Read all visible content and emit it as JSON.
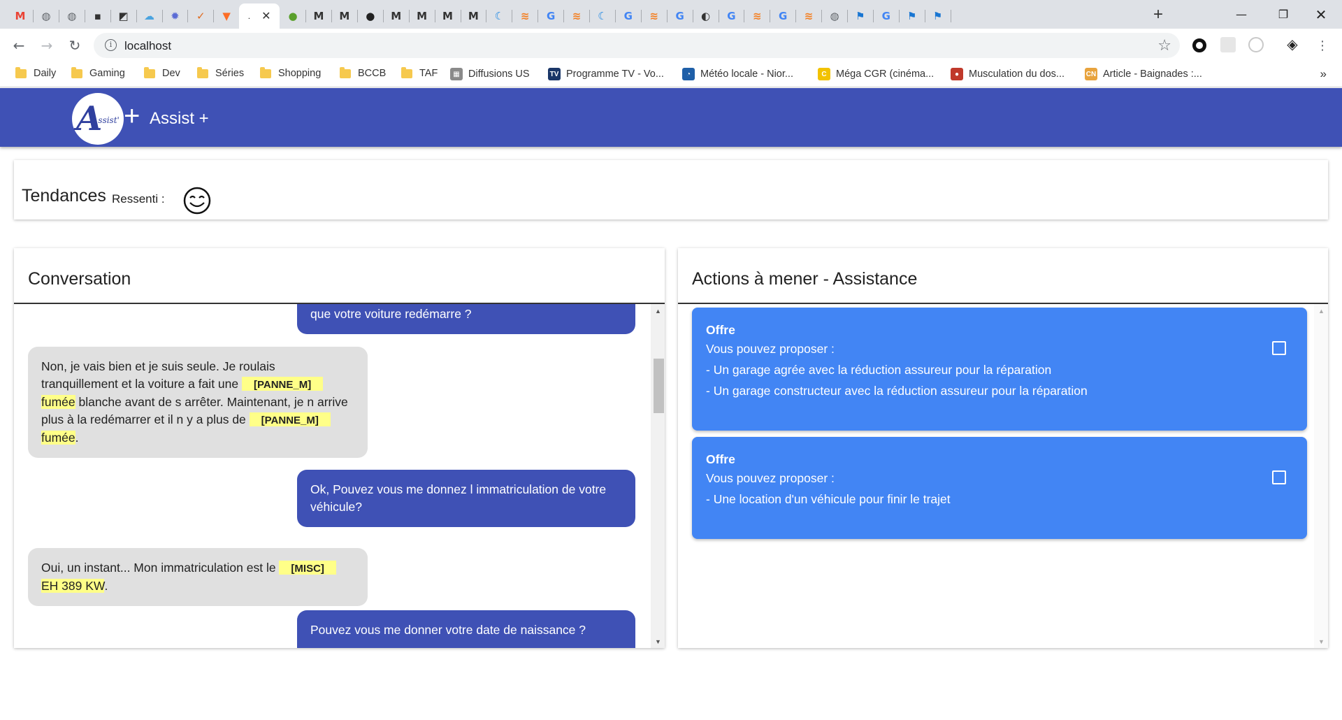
{
  "browser": {
    "tabs": [
      {
        "icon": "gmail-icon",
        "glyph": "M",
        "color": "#ea4335"
      },
      {
        "icon": "globe-icon",
        "glyph": "◍",
        "color": "#5f6368"
      },
      {
        "icon": "globe-icon",
        "glyph": "◍",
        "color": "#5f6368"
      },
      {
        "icon": "lock-icon",
        "glyph": "▪",
        "color": "#333333"
      },
      {
        "icon": "image-icon",
        "glyph": "◩",
        "color": "#333333"
      },
      {
        "icon": "cloud-icon",
        "glyph": "☁",
        "color": "#4aa3df"
      },
      {
        "icon": "gear-icon",
        "glyph": "✹",
        "color": "#5b6bd5"
      },
      {
        "icon": "check-shield-icon",
        "glyph": "✓",
        "color": "#e06b1f"
      },
      {
        "icon": "gitlab-icon",
        "glyph": "▼",
        "color": "#fc6d26"
      },
      {
        "icon": "active-tab",
        "glyph": "",
        "color": "#ffffff"
      },
      {
        "icon": "green-circle-icon",
        "glyph": "●",
        "color": "#5aa02c"
      },
      {
        "icon": "m-icon",
        "glyph": "M",
        "color": "#333333"
      },
      {
        "icon": "m-icon",
        "glyph": "M",
        "color": "#333333"
      },
      {
        "icon": "github-icon",
        "glyph": "●",
        "color": "#222222"
      },
      {
        "icon": "m-icon",
        "glyph": "M",
        "color": "#333333"
      },
      {
        "icon": "m-icon",
        "glyph": "M",
        "color": "#333333"
      },
      {
        "icon": "m-icon",
        "glyph": "M",
        "color": "#333333"
      },
      {
        "icon": "m-icon",
        "glyph": "M",
        "color": "#333333"
      },
      {
        "icon": "wave-icon",
        "glyph": "☾",
        "color": "#1e88e5"
      },
      {
        "icon": "stack-icon",
        "glyph": "≋",
        "color": "#f48024"
      },
      {
        "icon": "google-icon",
        "glyph": "G",
        "color": "#4285f4"
      },
      {
        "icon": "stack-icon",
        "glyph": "≋",
        "color": "#f48024"
      },
      {
        "icon": "wave-icon",
        "glyph": "☾",
        "color": "#1e88e5"
      },
      {
        "icon": "google-icon",
        "glyph": "G",
        "color": "#4285f4"
      },
      {
        "icon": "stack-icon",
        "glyph": "≋",
        "color": "#f48024"
      },
      {
        "icon": "google-icon",
        "glyph": "G",
        "color": "#4285f4"
      },
      {
        "icon": "half-circle-icon",
        "glyph": "◐",
        "color": "#333333"
      },
      {
        "icon": "google-icon",
        "glyph": "G",
        "color": "#4285f4"
      },
      {
        "icon": "stack-icon",
        "glyph": "≋",
        "color": "#f48024"
      },
      {
        "icon": "google-icon",
        "glyph": "G",
        "color": "#4285f4"
      },
      {
        "icon": "stack-icon",
        "glyph": "≋",
        "color": "#f48024"
      },
      {
        "icon": "globe-icon",
        "glyph": "◍",
        "color": "#5f6368"
      },
      {
        "icon": "flag-icon",
        "glyph": "⚑",
        "color": "#1976d2"
      },
      {
        "icon": "google-icon",
        "glyph": "G",
        "color": "#4285f4"
      },
      {
        "icon": "flag-icon",
        "glyph": "⚑",
        "color": "#1976d2"
      },
      {
        "icon": "flag-icon",
        "glyph": "⚑",
        "color": "#1976d2"
      }
    ],
    "active_tab_label": ".",
    "new_tab": "+",
    "url": "localhost",
    "bookmarks": [
      {
        "label": "Daily",
        "type": "folder"
      },
      {
        "label": "Gaming",
        "type": "folder"
      },
      {
        "label": "Dev",
        "type": "folder"
      },
      {
        "label": "Séries",
        "type": "folder"
      },
      {
        "label": "Shopping",
        "type": "folder"
      },
      {
        "label": "BCCB",
        "type": "folder"
      },
      {
        "label": "TAF",
        "type": "folder"
      },
      {
        "label": "Diffusions US",
        "type": "site",
        "icon_color": "#8a8a8a",
        "glyph": "▦"
      },
      {
        "label": "Programme TV - Vo...",
        "type": "site",
        "icon_color": "#1a3668",
        "glyph": "TV"
      },
      {
        "label": "Météo locale - Nior...",
        "type": "site",
        "icon_color": "#1f5fa8",
        "glyph": "◔"
      },
      {
        "label": "Méga CGR (cinéma...",
        "type": "site",
        "icon_color": "#f2c200",
        "glyph": "C"
      },
      {
        "label": "Musculation du dos...",
        "type": "site",
        "icon_color": "#c0392b",
        "glyph": "●"
      },
      {
        "label": "Article - Baignades :...",
        "type": "site",
        "icon_color": "#e8a33d",
        "glyph": "CN"
      }
    ],
    "bookmarks_more": "»"
  },
  "app": {
    "logo_letter": "A",
    "logo_small": "ssist'",
    "logo_plus": "+",
    "title": "Assist +",
    "primary_color": "#3f51b5",
    "offer_color": "#4285f4",
    "tag_color": "#ffff88"
  },
  "trends": {
    "title": "Tendances",
    "ressenti_label": "Ressenti :",
    "mood_icon": "smiley-face-icon"
  },
  "conversation": {
    "title": "Conversation",
    "messages": [
      {
        "role": "agent",
        "text": "que votre voiture redémarre ?"
      },
      {
        "role": "client",
        "parts": [
          {
            "t": "Non, je vais bien et je suis seule. Je roulais tranquillement et la voiture a fait une "
          },
          {
            "tag": "[PANNE_M]",
            "t": "fumée"
          },
          {
            "t": " blanche avant de s arrêter. Maintenant, je n arrive plus à la redémarrer et il n y a plus de "
          },
          {
            "tag": "[PANNE_M]",
            "t": "fumée"
          },
          {
            "t": "."
          }
        ]
      },
      {
        "role": "agent",
        "text": "Ok, Pouvez vous me donnez l immatriculation de votre véhicule?"
      },
      {
        "role": "client",
        "parts": [
          {
            "t": "Oui, un instant... Mon immatriculation est le "
          },
          {
            "tag": "[MISC]",
            "t": "EH 389 KW"
          },
          {
            "t": "."
          }
        ]
      },
      {
        "role": "agent",
        "text": "Pouvez vous me donner votre date de naissance ?"
      }
    ]
  },
  "actions": {
    "title": "Actions à mener - Assistance",
    "offers": [
      {
        "heading": "Offre",
        "intro": "Vous pouvez proposer :",
        "items": [
          "- Un garage agrée avec la réduction assureur pour la réparation",
          "- Un garage constructeur avec la réduction assureur pour la réparation"
        ],
        "checked": false
      },
      {
        "heading": "Offre",
        "intro": "Vous pouvez proposer :",
        "items": [
          "- Une location d'un véhicule pour finir le trajet"
        ],
        "checked": false
      }
    ]
  }
}
